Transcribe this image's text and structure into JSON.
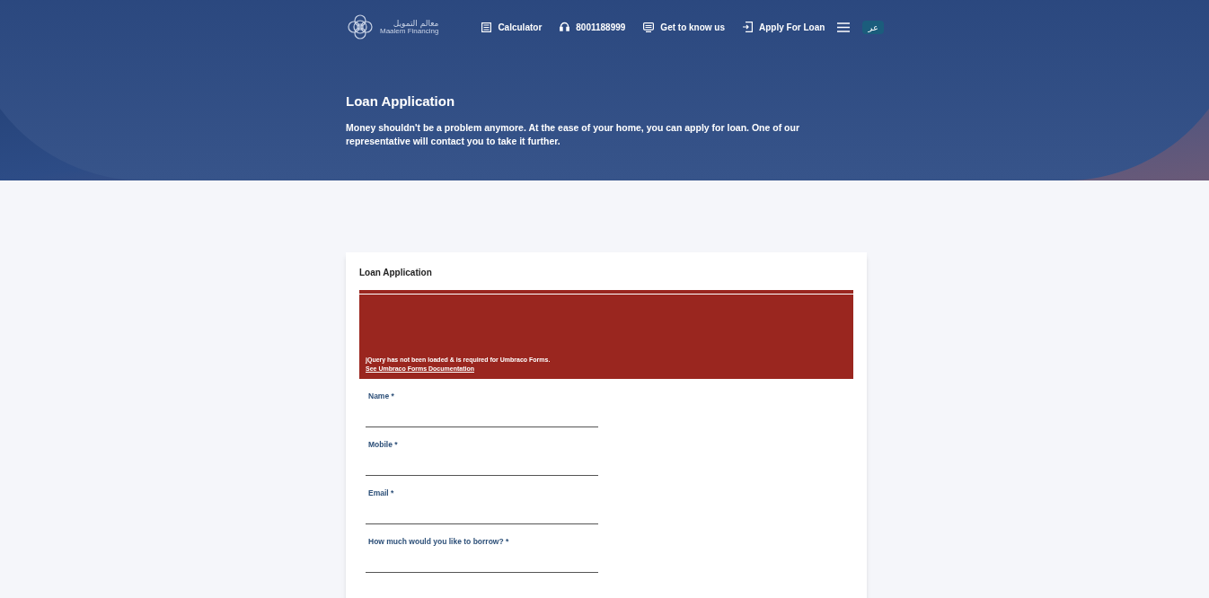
{
  "header": {
    "logo": {
      "arabic": "معالم التمويل",
      "name": "Maalem Financing"
    },
    "nav": [
      {
        "kind": "calculator",
        "label": "Calculator"
      },
      {
        "kind": "phone",
        "label": "8001188999"
      },
      {
        "kind": "about",
        "label": "Get to know us"
      },
      {
        "kind": "apply",
        "label": "Apply For Loan"
      }
    ],
    "language": "عر"
  },
  "hero": {
    "title": "Loan Application",
    "text": "Money shouldn't be a problem anymore. At the ease of your home, you can apply for loan. One of our representative will contact you to take it further."
  },
  "form": {
    "title": "Loan Application",
    "error": {
      "message": "jQuery has not been loaded & is required for Umbraco Forms.",
      "link": "See Umbraco Forms Documentation"
    },
    "fields": [
      {
        "label": "Name *"
      },
      {
        "label": "Mobile *"
      },
      {
        "label": "Email *"
      },
      {
        "label": "How much would you like to borrow? *"
      }
    ]
  }
}
